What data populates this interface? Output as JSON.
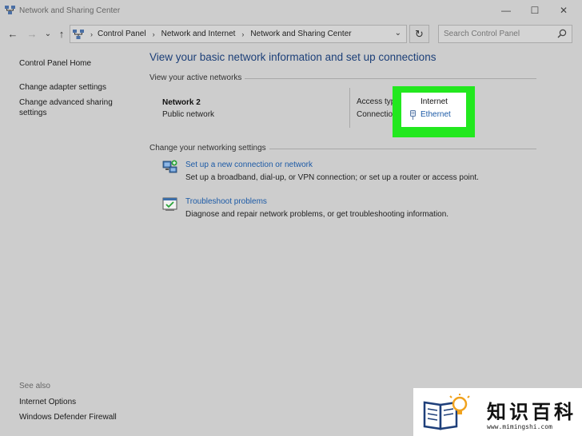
{
  "window": {
    "title": "Network and Sharing Center",
    "minimize_glyph": "—",
    "maximize_glyph": "☐",
    "close_glyph": "✕"
  },
  "nav": {
    "back_glyph": "←",
    "forward_glyph": "→",
    "recent_glyph": "⌄",
    "up_glyph": "↑",
    "refresh_glyph": "↻",
    "dropdown_glyph": "⌄"
  },
  "breadcrumb": [
    "Control Panel",
    "Network and Internet",
    "Network and Sharing Center"
  ],
  "breadcrumb_sep": "›",
  "search": {
    "placeholder": "Search Control Panel"
  },
  "sidebar": {
    "home": "Control Panel Home",
    "adapter": "Change adapter settings",
    "advanced_line1": "Change advanced sharing",
    "advanced_line2": "settings",
    "see_also": "See also",
    "internet_options": "Internet Options",
    "firewall": "Windows Defender Firewall"
  },
  "main": {
    "title": "View your basic network information and set up connections",
    "active_networks_label": "View your active networks",
    "network_name": "Network 2",
    "network_type": "Public network",
    "access_type_label": "Access type:",
    "access_type_value": "Internet",
    "connections_label": "Connections:",
    "connection_value": "Ethernet",
    "change_settings_label": "Change your networking settings",
    "task1_link": "Set up a new connection or network",
    "task1_desc": "Set up a broadband, dial-up, or VPN connection; or set up a router or access point.",
    "task2_link": "Troubleshoot problems",
    "task2_desc": "Diagnose and repair network problems, or get troubleshooting information."
  },
  "watermark": {
    "text": "知识百科",
    "url": "www.mimingshi.com"
  },
  "colors": {
    "background": "#cdcdcd",
    "link": "#1c5aa6",
    "title": "#1c3f78",
    "highlight": "#22e81e"
  }
}
